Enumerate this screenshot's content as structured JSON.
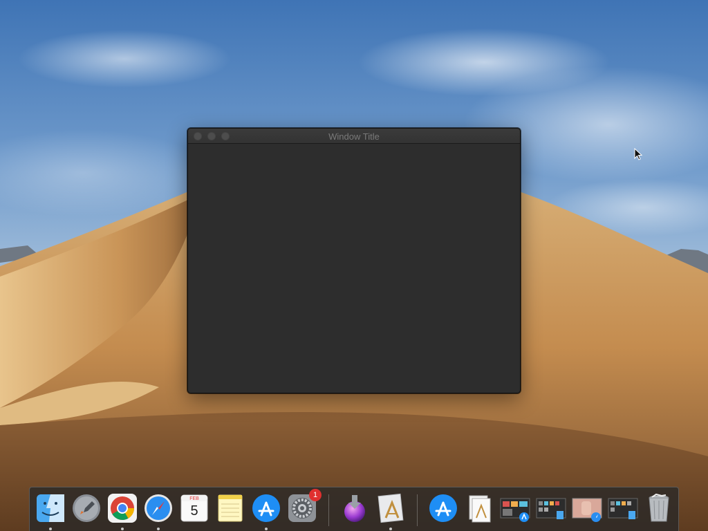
{
  "window": {
    "title": "Window Title"
  },
  "dock": {
    "items": [
      {
        "name": "finder",
        "icon": "finder-icon",
        "running": true
      },
      {
        "name": "launchpad",
        "icon": "rocket-icon",
        "running": false
      },
      {
        "name": "chrome",
        "icon": "chrome-icon",
        "running": true
      },
      {
        "name": "safari",
        "icon": "compass-icon",
        "running": true
      },
      {
        "name": "calendar",
        "icon": "calendar-icon",
        "running": false,
        "month": "FEB",
        "day": "5"
      },
      {
        "name": "notes",
        "icon": "notepad-icon",
        "running": false
      },
      {
        "name": "app-store",
        "icon": "app-store-icon",
        "running": true
      },
      {
        "name": "system-preferences",
        "icon": "gear-icon",
        "running": false,
        "badge": "1"
      },
      {
        "name": "installer",
        "icon": "download-orb-icon",
        "running": false
      },
      {
        "name": "xcode-document",
        "icon": "drafting-document-icon",
        "running": true
      },
      {
        "name": "app-store-download",
        "icon": "app-store-icon",
        "running": false
      },
      {
        "name": "document-folder",
        "icon": "document-icon",
        "running": false
      },
      {
        "name": "screenshot-1",
        "icon": "window-thumbnail-icon",
        "running": false
      },
      {
        "name": "screenshot-2",
        "icon": "window-thumbnail-icon",
        "running": false
      },
      {
        "name": "image-thumbnail",
        "icon": "photo-thumbnail-icon",
        "running": false
      },
      {
        "name": "screenshot-3",
        "icon": "window-thumbnail-icon",
        "running": false
      },
      {
        "name": "trash",
        "icon": "trash-icon",
        "running": false
      }
    ]
  },
  "colors": {
    "window_bg": "#2d2d2d",
    "titlebar_text": "#7a7a7a",
    "badge": "#e0302f"
  }
}
